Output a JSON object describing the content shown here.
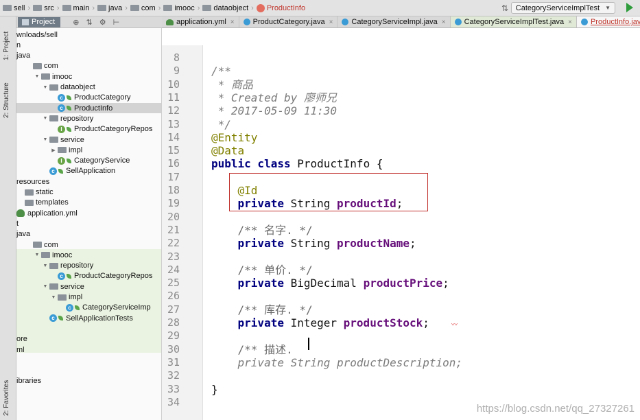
{
  "breadcrumb": [
    "sell",
    "src",
    "main",
    "java",
    "com",
    "imooc",
    "dataobject",
    "ProductInfo"
  ],
  "run_config": "CategoryServiceImplTest",
  "left_strip": {
    "project": "1: Project",
    "structure": "2: Structure",
    "favorites": "2: Favorites"
  },
  "project_panel": {
    "tab": "Project",
    "controls": {
      "target": "⊕",
      "collapse": "⇅",
      "gear": "⚙",
      "hide": "⊢"
    },
    "tree": [
      {
        "text": "wnloads/sell",
        "kind": "text",
        "indent": 0
      },
      {
        "text": "n",
        "kind": "text",
        "indent": 0
      },
      {
        "text": "java",
        "kind": "text",
        "indent": 0
      },
      {
        "text": "com",
        "kind": "folder",
        "indent": 1,
        "tri": ""
      },
      {
        "text": "imooc",
        "kind": "folder",
        "indent": 2,
        "tri": "▼"
      },
      {
        "text": "dataobject",
        "kind": "folder",
        "indent": 3,
        "tri": "▼"
      },
      {
        "text": "ProductCategory",
        "kind": "class",
        "indent": 5
      },
      {
        "text": "ProductInfo",
        "kind": "class",
        "indent": 5,
        "selected": true
      },
      {
        "text": "repository",
        "kind": "folder",
        "indent": 3,
        "tri": "▼"
      },
      {
        "text": "ProductCategoryRepos",
        "kind": "interface",
        "indent": 5
      },
      {
        "text": "service",
        "kind": "folder",
        "indent": 3,
        "tri": "▼"
      },
      {
        "text": "impl",
        "kind": "folder",
        "indent": 4,
        "tri": "▶"
      },
      {
        "text": "CategoryService",
        "kind": "interface",
        "indent": 5
      },
      {
        "text": "SellApplication",
        "kind": "class",
        "indent": 4
      },
      {
        "text": "resources",
        "kind": "text",
        "indent": 0
      },
      {
        "text": "static",
        "kind": "folder",
        "indent": 0
      },
      {
        "text": "templates",
        "kind": "folder",
        "indent": 0
      },
      {
        "text": "application.yml",
        "kind": "yml",
        "indent": 0
      },
      {
        "text": "t",
        "kind": "text",
        "indent": 0
      },
      {
        "text": "java",
        "kind": "text",
        "indent": 0
      },
      {
        "text": "com",
        "kind": "folder",
        "indent": 1,
        "tri": ""
      },
      {
        "text": "imooc",
        "kind": "folder",
        "indent": 2,
        "tri": "▼"
      },
      {
        "text": "repository",
        "kind": "folder",
        "indent": 3,
        "tri": "▼"
      },
      {
        "text": "ProductCategoryRepos",
        "kind": "class",
        "indent": 5
      },
      {
        "text": "service",
        "kind": "folder",
        "indent": 3,
        "tri": "▼"
      },
      {
        "text": "impl",
        "kind": "folder",
        "indent": 4,
        "tri": "▼"
      },
      {
        "text": "CategoryServiceImp",
        "kind": "class",
        "indent": 6
      },
      {
        "text": "SellApplicationTests",
        "kind": "class",
        "indent": 4
      },
      {
        "text": "",
        "kind": "text",
        "indent": 0
      },
      {
        "text": "ore",
        "kind": "text",
        "indent": 0
      },
      {
        "text": "ml",
        "kind": "text",
        "indent": 0
      },
      {
        "text": "",
        "kind": "text",
        "indent": 0
      },
      {
        "text": "",
        "kind": "text",
        "indent": 0
      },
      {
        "text": "ibraries",
        "kind": "text",
        "indent": 0
      }
    ]
  },
  "tabs": [
    {
      "label": "application.yml",
      "icon": "yml"
    },
    {
      "label": "ProductCategory.java",
      "icon": "class"
    },
    {
      "label": "CategoryServiceImpl.java",
      "icon": "class"
    },
    {
      "label": "CategoryServiceImplTest.java",
      "icon": "class",
      "test": true
    },
    {
      "label": "ProductInfo.java",
      "icon": "class",
      "active": true
    }
  ],
  "code": [
    {
      "n": "8",
      "t": []
    },
    {
      "n": "9",
      "t": [
        [
          "/**",
          "com"
        ]
      ],
      "fold": true
    },
    {
      "n": "10",
      "t": [
        [
          " * 商品",
          "com"
        ]
      ]
    },
    {
      "n": "11",
      "t": [
        [
          " * Created by 廖师兄",
          "com"
        ]
      ]
    },
    {
      "n": "12",
      "t": [
        [
          " * 2017-05-09 11:30",
          "com"
        ]
      ]
    },
    {
      "n": "13",
      "t": [
        [
          " */",
          "com"
        ]
      ],
      "fold": true
    },
    {
      "n": "14",
      "t": [
        [
          "@Entity",
          "ann"
        ]
      ],
      "fold": true
    },
    {
      "n": "15",
      "t": [
        [
          "@Data",
          "ann"
        ]
      ],
      "fold": true
    },
    {
      "n": "16",
      "t": [
        [
          "public class ",
          "kw"
        ],
        [
          "ProductInfo {",
          ""
        ]
      ]
    },
    {
      "n": "17",
      "t": []
    },
    {
      "n": "18",
      "t": [
        [
          "    ",
          ""
        ],
        [
          "@Id",
          "ann"
        ]
      ]
    },
    {
      "n": "19",
      "t": [
        [
          "    ",
          ""
        ],
        [
          "private ",
          "kw"
        ],
        [
          "String ",
          ""
        ],
        [
          "productId",
          "fld"
        ],
        [
          ";",
          ""
        ]
      ]
    },
    {
      "n": "20",
      "t": []
    },
    {
      "n": "21",
      "t": [
        [
          "    ",
          ""
        ],
        [
          "/** 名字. */",
          "jc"
        ]
      ]
    },
    {
      "n": "22",
      "t": [
        [
          "    ",
          ""
        ],
        [
          "private ",
          "kw"
        ],
        [
          "String ",
          ""
        ],
        [
          "productName",
          "fld"
        ],
        [
          ";",
          ""
        ]
      ]
    },
    {
      "n": "23",
      "t": []
    },
    {
      "n": "24",
      "t": [
        [
          "    ",
          ""
        ],
        [
          "/** 单价. */",
          "jc"
        ]
      ]
    },
    {
      "n": "25",
      "t": [
        [
          "    ",
          ""
        ],
        [
          "private ",
          "kw"
        ],
        [
          "BigDecimal ",
          ""
        ],
        [
          "productPrice",
          "fld"
        ],
        [
          ";",
          ""
        ]
      ]
    },
    {
      "n": "26",
      "t": []
    },
    {
      "n": "27",
      "t": [
        [
          "    ",
          ""
        ],
        [
          "/** 库存. */",
          "jc"
        ]
      ]
    },
    {
      "n": "28",
      "t": [
        [
          "    ",
          ""
        ],
        [
          "private ",
          "kw"
        ],
        [
          "Integer ",
          ""
        ],
        [
          "productStock",
          "fld"
        ],
        [
          ";",
          ""
        ]
      ]
    },
    {
      "n": "29",
      "t": []
    },
    {
      "n": "30",
      "t": [
        [
          "    ",
          ""
        ],
        [
          "/** 描述. ",
          "jc"
        ]
      ]
    },
    {
      "n": "31",
      "t": [
        [
          "    ",
          ""
        ],
        [
          "private String productDescription;",
          "com"
        ]
      ]
    },
    {
      "n": "32",
      "t": []
    },
    {
      "n": "33",
      "t": [
        [
          "}",
          ""
        ]
      ],
      "fold": true
    },
    {
      "n": "34",
      "t": []
    }
  ],
  "watermark": "https://blog.csdn.net/qq_27327261"
}
